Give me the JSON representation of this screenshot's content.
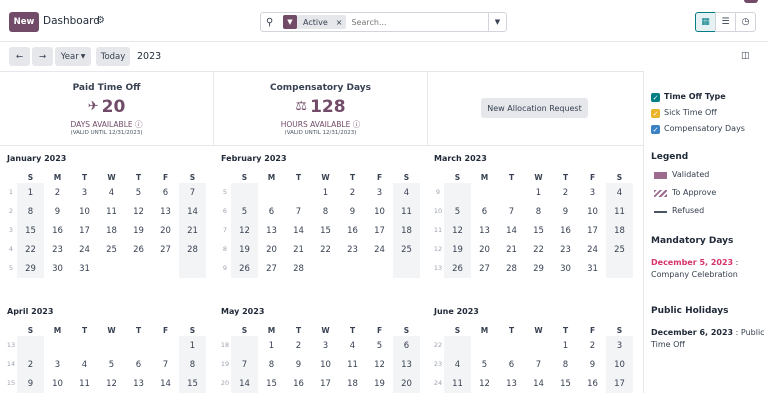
{
  "header": {
    "new_label": "New",
    "title": "Dashboard",
    "search_facet": "Active",
    "search_placeholder": "Search...",
    "views": [
      "calendar-icon",
      "list-icon",
      "activity-icon"
    ]
  },
  "controls": {
    "year_dropdown": "Year",
    "today": "Today",
    "year": "2023"
  },
  "summary": [
    {
      "title": "Paid Time Off",
      "value": "20",
      "unit": "DAYS AVAILABLE",
      "valid": "(VALID UNTIL 12/31/2023)"
    },
    {
      "title": "Compensatory Days",
      "value": "128",
      "unit": "HOURS AVAILABLE",
      "valid": "(VALID UNTIL 12/31/2023)"
    }
  ],
  "allocation_button": "New Allocation Request",
  "weekday_headers": [
    "S",
    "M",
    "T",
    "W",
    "T",
    "F",
    "S"
  ],
  "months": [
    {
      "name": "January 2023",
      "weeks": [
        [
          "1",
          "1",
          "2",
          "3",
          "4",
          "5",
          "6",
          "7"
        ],
        [
          "2",
          "8",
          "9",
          "10",
          "11",
          "12",
          "13",
          "14"
        ],
        [
          "3",
          "15",
          "16",
          "17",
          "18",
          "19",
          "20",
          "21"
        ],
        [
          "4",
          "22",
          "23",
          "24",
          "25",
          "26",
          "27",
          "28"
        ],
        [
          "5",
          "29",
          "30",
          "31",
          "",
          "",
          "",
          ""
        ]
      ]
    },
    {
      "name": "February 2023",
      "weeks": [
        [
          "5",
          "",
          "",
          "",
          "1",
          "2",
          "3",
          "4"
        ],
        [
          "6",
          "5",
          "6",
          "7",
          "8",
          "9",
          "10",
          "11"
        ],
        [
          "7",
          "12",
          "13",
          "14",
          "15",
          "16",
          "17",
          "18"
        ],
        [
          "8",
          "19",
          "20",
          "21",
          "22",
          "23",
          "24",
          "25"
        ],
        [
          "9",
          "26",
          "27",
          "28",
          "",
          "",
          "",
          ""
        ]
      ]
    },
    {
      "name": "March 2023",
      "weeks": [
        [
          "9",
          "",
          "",
          "",
          "1",
          "2",
          "3",
          "4"
        ],
        [
          "10",
          "5",
          "6",
          "7",
          "8",
          "9",
          "10",
          "11"
        ],
        [
          "11",
          "12",
          "13",
          "14",
          "15",
          "16",
          "17",
          "18"
        ],
        [
          "12",
          "19",
          "20",
          "21",
          "22",
          "23",
          "24",
          "25"
        ],
        [
          "13",
          "26",
          "27",
          "28",
          "29",
          "30",
          "31",
          ""
        ]
      ]
    },
    {
      "name": "April 2023",
      "weeks": [
        [
          "13",
          "",
          "",
          "",
          "",
          "",
          "",
          "1"
        ],
        [
          "14",
          "2",
          "3",
          "4",
          "5",
          "6",
          "7",
          "8"
        ],
        [
          "15",
          "9",
          "10",
          "11",
          "12",
          "13",
          "14",
          "15"
        ]
      ]
    },
    {
      "name": "May 2023",
      "weeks": [
        [
          "18",
          "",
          "1",
          "2",
          "3",
          "4",
          "5",
          "6"
        ],
        [
          "19",
          "7",
          "8",
          "9",
          "10",
          "11",
          "12",
          "13"
        ],
        [
          "20",
          "14",
          "15",
          "16",
          "17",
          "18",
          "19",
          "20"
        ]
      ]
    },
    {
      "name": "June 2023",
      "weeks": [
        [
          "22",
          "",
          "",
          "",
          "",
          "1",
          "2",
          "3"
        ],
        [
          "23",
          "4",
          "5",
          "6",
          "7",
          "8",
          "9",
          "10"
        ],
        [
          "24",
          "11",
          "12",
          "13",
          "14",
          "15",
          "16",
          "17"
        ]
      ]
    }
  ],
  "sidebar": {
    "filters": [
      {
        "label": "Time Off Type",
        "color": "#017e84",
        "bold": true
      },
      {
        "label": "Sick Time Off",
        "color": "#e9b429",
        "bold": false
      },
      {
        "label": "Compensatory Days",
        "color": "#3b82c4",
        "bold": false
      }
    ],
    "legend_title": "Legend",
    "legend": [
      {
        "label": "Validated",
        "style": "solid",
        "color": "#9c6b8e"
      },
      {
        "label": "To Approve",
        "style": "hatched",
        "color": "#9c6b8e"
      },
      {
        "label": "Refused",
        "style": "line",
        "color": "#4b5563"
      }
    ],
    "mandatory_title": "Mandatory Days",
    "mandatory_date": "December 5, 2023",
    "mandatory_sep": " :",
    "mandatory_name": "Company Celebration",
    "holidays_title": "Public Holidays",
    "holiday_date": "December 6, 2023",
    "holiday_rest": " : Public",
    "holiday_rest2": "Time Off"
  }
}
